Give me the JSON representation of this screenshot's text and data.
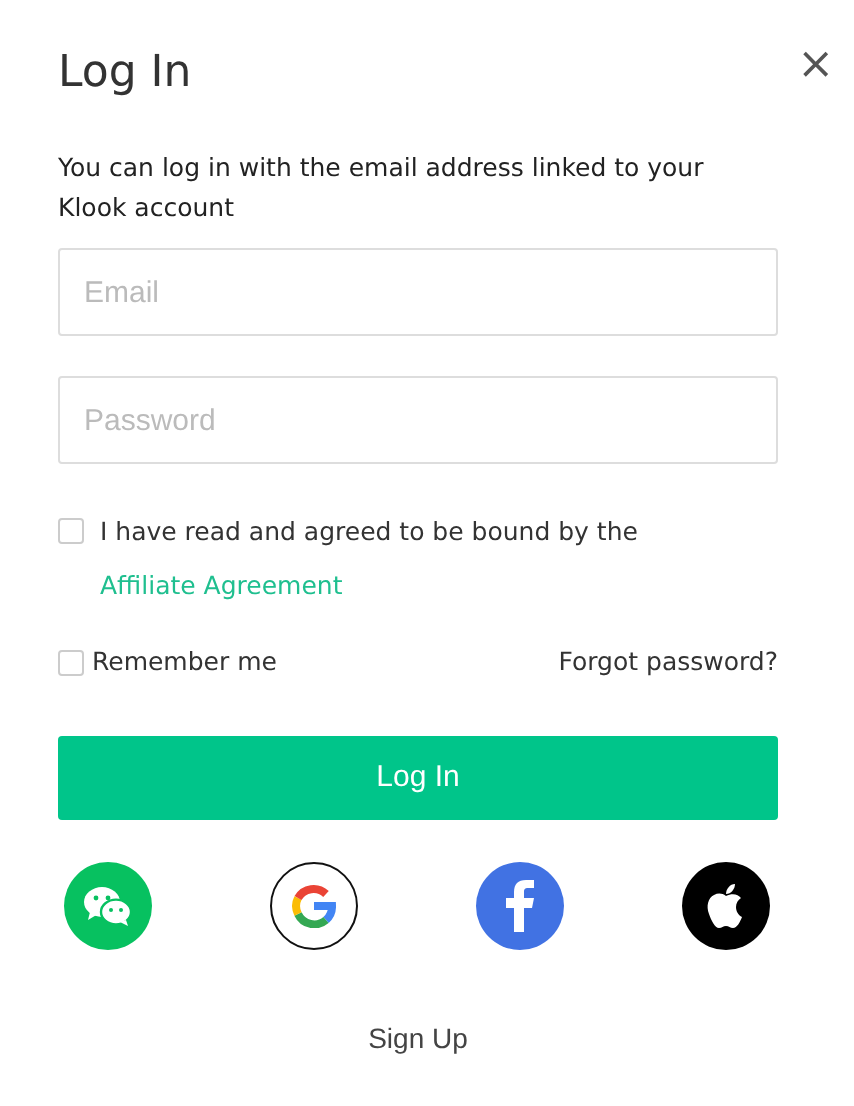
{
  "close": "×",
  "title": "Log In",
  "description": "You can log in with the email address linked to your Klook account",
  "fields": [
    {
      "placeholder": "Email"
    },
    {
      "placeholder": "Password"
    }
  ],
  "agreement": {
    "checked": false,
    "text": "I have read and agreed to be bound by the",
    "link": "Affiliate Agreement"
  },
  "remember": {
    "checked": false,
    "label": "Remember me"
  },
  "forgot": "Forgot password?",
  "submit": "Log In",
  "social": [
    {
      "kind": "wechat"
    },
    {
      "kind": "google"
    },
    {
      "kind": "facebook"
    },
    {
      "kind": "apple"
    }
  ],
  "signup": "Sign Up"
}
